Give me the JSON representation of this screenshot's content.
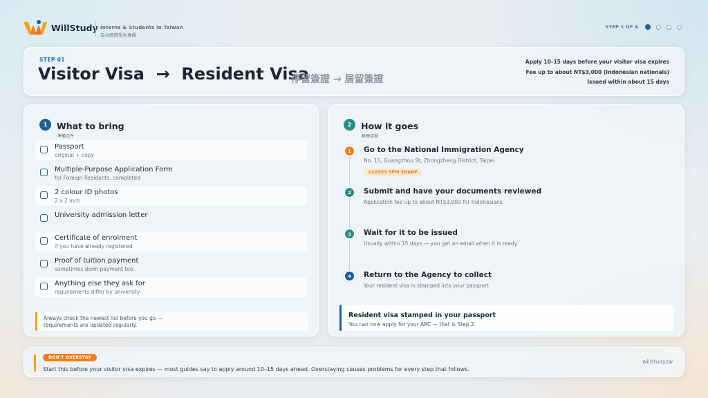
{
  "header": {
    "brand": "WillStudy",
    "tagline": "Interns & Students in Taiwan",
    "tagline_zh": "在台國際學生專欄",
    "step_indicator": "STEP 1 OF 4",
    "total_steps": 4,
    "current_step": 1
  },
  "title_card": {
    "step_label": "STEP 01",
    "title": "Visitor Visa  →  Resident Visa",
    "title_zh": "停留簽證 → 居留簽證",
    "facts": [
      "Apply 10–15 days before your visitor visa expires",
      "Fee up to about NT$3,000 (Indonesian nationals)",
      "Issued within about 15 days"
    ]
  },
  "bring": {
    "number": "1",
    "title": "What to bring",
    "title_zh": "準備文件",
    "items": [
      {
        "label": "Passport",
        "sub": "original + copy"
      },
      {
        "label": "Multiple-Purpose Application Form",
        "sub": "for Foreign Residents, completed"
      },
      {
        "label": "2 colour ID photos",
        "sub": "2 x 2 inch"
      },
      {
        "label": "University admission letter",
        "sub": ""
      },
      {
        "label": "Certificate of enrolment",
        "sub": "if you have already registered"
      },
      {
        "label": "Proof of tuition payment",
        "sub": "sometimes dorm payment too"
      },
      {
        "label": "Anything else they ask for",
        "sub": "requirements differ by university"
      }
    ],
    "note_line1": "Always check the newest list before you go —",
    "note_line2": "requirements are updated regularly."
  },
  "process": {
    "number": "2",
    "title": "How it goes",
    "title_zh": "辦理流程",
    "steps": [
      {
        "num": "1",
        "title": "Go to the National Immigration Agency",
        "desc": "No. 15, Guangzhou St, Zhongzheng District, Taipei",
        "badge": "CLOSES 5PM SHARP"
      },
      {
        "num": "2",
        "title": "Submit and have your documents reviewed",
        "desc": "Application fee up to about NT$3,000 for Indonesians"
      },
      {
        "num": "3",
        "title": "Wait for it to be issued",
        "desc": "Usually within 15 days — you get an email when it is ready"
      },
      {
        "num": "4",
        "title": "Return to the Agency to collect",
        "desc": "Your resident visa is stamped into your passport"
      }
    ],
    "result_title": "Resident visa stamped in your passport",
    "result_sub": "You can now apply for your ARC — that is Step 2."
  },
  "footer": {
    "badge": "DON'T OVERSTAY",
    "text": "Start this before your visitor visa expires — most guides say to apply around 10–15 days ahead. Overstaying causes problems for every step that follows.",
    "site": "willstudy.tw"
  },
  "colors": {
    "accent_blue": "#1d5f8f",
    "accent_teal": "#2a8c8a",
    "accent_orange": "#f07e1c",
    "accent_amber": "#f2a21b"
  }
}
